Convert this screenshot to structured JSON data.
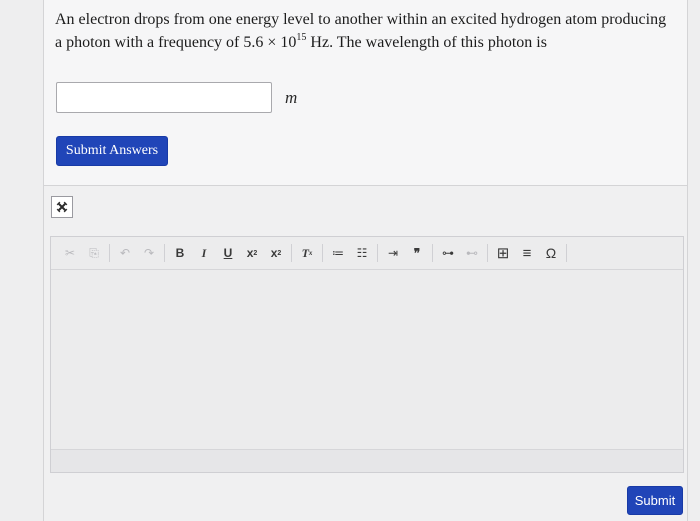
{
  "question": {
    "line1": "An electron drops from one energy level to another within an excited hydrogen atom producing",
    "line2_prefix": "a photon with a frequency of 5.6 × 10",
    "line2_exp": "15",
    "line2_suffix": " Hz. The wavelength of this photon is"
  },
  "answer": {
    "value": "",
    "placeholder": "",
    "unit": "m"
  },
  "buttons": {
    "submit_answers": "Submit Answers",
    "submit": "Submit"
  },
  "toolbar": {
    "cut": "✂",
    "copy": "⎘",
    "undo": "↶",
    "redo": "↷",
    "bold": "B",
    "italic": "I",
    "underline": "U",
    "subscript": "x",
    "superscript": "x",
    "remove_format": "T",
    "numbered_list": "≔",
    "bulleted_list": "☷",
    "indent": "⇥",
    "blockquote": "❞",
    "link": "⊶",
    "unlink": "⊷",
    "table": "⊞",
    "horizontal_line": "≡",
    "special_char": "Ω"
  },
  "colors": {
    "primary_button": "#2045b8",
    "background": "#eeeeef"
  }
}
